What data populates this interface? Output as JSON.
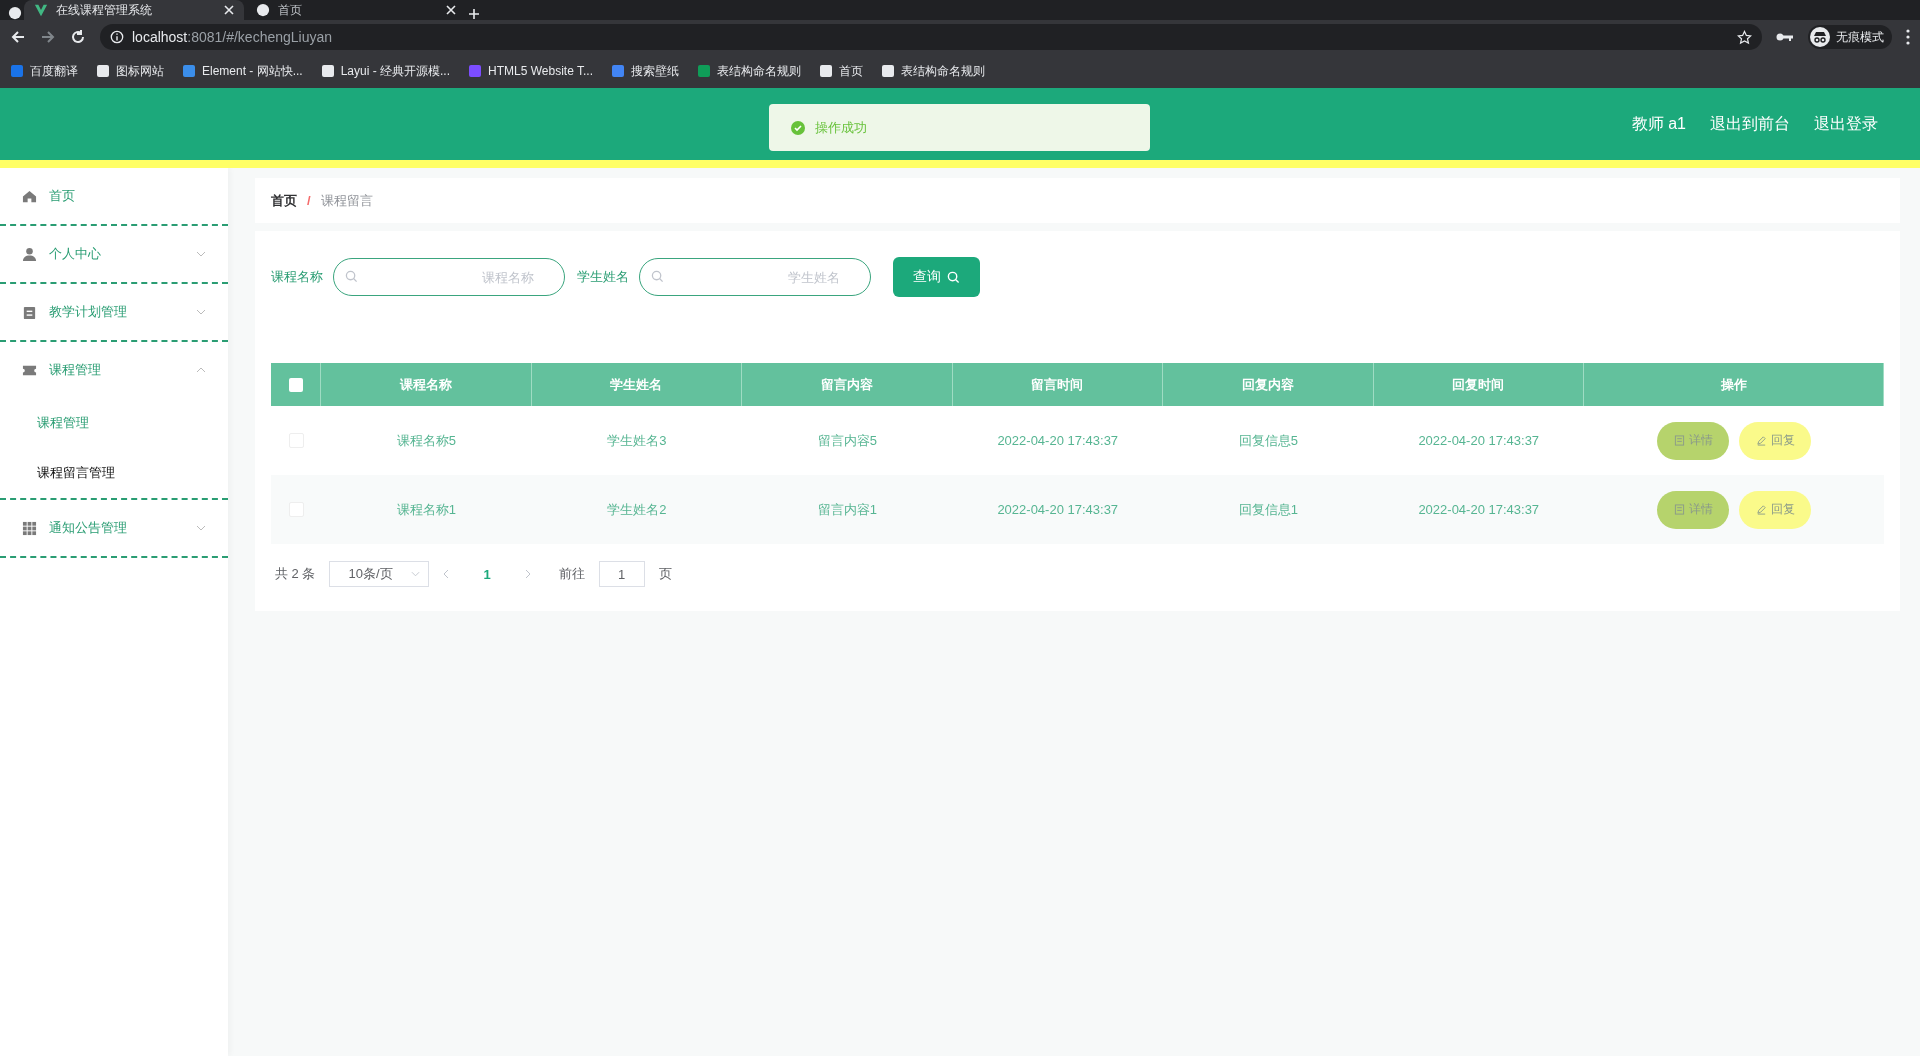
{
  "browser": {
    "tabs": [
      {
        "title": "在线课程管理系统",
        "selected": true
      },
      {
        "title": "首页",
        "selected": false
      }
    ],
    "url_host": "localhost",
    "url_path": ":8081/#/kechengLiuyan",
    "incognito": "无痕模式",
    "bookmarks": [
      {
        "label": "百度翻译"
      },
      {
        "label": "图标网站"
      },
      {
        "label": "Element - 网站快..."
      },
      {
        "label": "Layui - 经典开源模..."
      },
      {
        "label": "HTML5 Website T..."
      },
      {
        "label": "搜索壁纸"
      },
      {
        "label": "表结构命名规则"
      },
      {
        "label": "首页"
      },
      {
        "label": "表结构命名规则"
      }
    ]
  },
  "header": {
    "toast": "操作成功",
    "user": "教师 a1",
    "links": [
      "退出到前台",
      "退出登录"
    ]
  },
  "sidebar": {
    "items": [
      {
        "label": "首页",
        "kind": "home"
      },
      {
        "label": "个人中心",
        "kind": "person",
        "expanded": false
      },
      {
        "label": "教学计划管理",
        "kind": "clipboard",
        "expanded": false
      },
      {
        "label": "课程管理",
        "kind": "ticket",
        "expanded": true,
        "children": [
          {
            "label": "课程管理",
            "selected": false
          },
          {
            "label": "课程留言管理",
            "selected": true
          }
        ]
      },
      {
        "label": "通知公告管理",
        "kind": "grid",
        "expanded": false
      }
    ]
  },
  "breadcrumb": {
    "items": [
      "首页",
      "课程留言"
    ],
    "separator": "/"
  },
  "search": {
    "fields": [
      {
        "label": "课程名称",
        "placeholder": "课程名称"
      },
      {
        "label": "学生姓名",
        "placeholder": "学生姓名"
      }
    ],
    "button": "查询"
  },
  "table": {
    "select_all_checked": false,
    "columns": [
      "课程名称",
      "学生姓名",
      "留言内容",
      "留言时间",
      "回复内容",
      "回复时间",
      "操作"
    ],
    "rows": [
      {
        "checked": false,
        "cells": [
          "课程名称5",
          "学生姓名3",
          "留言内容5",
          "2022-04-20 17:43:37",
          "回复信息5",
          "2022-04-20 17:43:37"
        ],
        "actions": [
          "详情",
          "回复"
        ]
      },
      {
        "checked": false,
        "cells": [
          "课程名称1",
          "学生姓名2",
          "留言内容1",
          "2022-04-20 17:43:37",
          "回复信息1",
          "2022-04-20 17:43:37"
        ],
        "actions": [
          "详情",
          "回复"
        ]
      }
    ]
  },
  "pagination": {
    "total": "共 2 条",
    "page_size": "10条/页",
    "page": "1",
    "goto_label": "前往",
    "goto_value": "1",
    "page_suffix": "页"
  }
}
